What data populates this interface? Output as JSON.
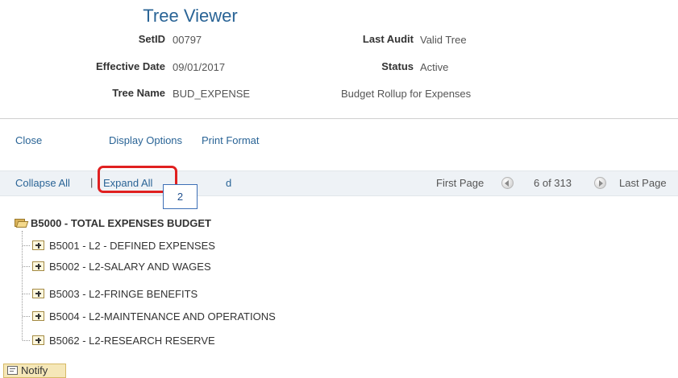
{
  "page": {
    "title": "Tree Viewer"
  },
  "fields": {
    "setid_label": "SetID",
    "setid_value": "00797",
    "last_audit_label": "Last Audit",
    "last_audit_value": "Valid Tree",
    "effective_date_label": "Effective Date",
    "effective_date_value": "09/01/2017",
    "status_label": "Status",
    "status_value": "Active",
    "tree_name_label": "Tree Name",
    "tree_name_value": "BUD_EXPENSE",
    "tree_description": "Budget Rollup for Expenses"
  },
  "actions": {
    "close": "Close",
    "display_options": "Display Options",
    "print_format": "Print Format"
  },
  "toolbar": {
    "collapse_all": "Collapse All",
    "separator": "|",
    "expand_all": "Expand All",
    "find_partial": "d",
    "first_page": "First Page",
    "page_info": "6 of 313",
    "last_page": "Last Page"
  },
  "annotation": {
    "callout_number": "2",
    "highlight_color": "#e02020"
  },
  "tree": {
    "root": "B5000 - TOTAL EXPENSES BUDGET",
    "children": [
      "B5001 - L2 - DEFINED EXPENSES",
      "B5002 - L2-SALARY AND WAGES",
      "B5003 - L2-FRINGE BENEFITS",
      "B5004 - L2-MAINTENANCE AND OPERATIONS",
      "B5062 - L2-RESEARCH RESERVE"
    ]
  },
  "footer": {
    "notify": "Notify"
  },
  "colors": {
    "link": "#2a6496",
    "toolbar_bg": "#eef2f6",
    "notify_bg": "#f5e7b8"
  }
}
